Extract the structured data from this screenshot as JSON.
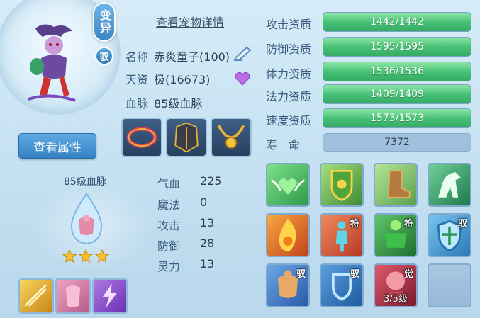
{
  "pet": {
    "mutation_badge": "变异",
    "bind_badge": "驭",
    "detail_link": "查看宠物详情",
    "name_label": "名称",
    "name_value": "赤炎童子(100)",
    "talent_label": "天资",
    "talent_value": "极(16673)",
    "bloodline_label": "血脉",
    "bloodline_value": "85级血脉",
    "view_attr_button": "查看属性"
  },
  "bloodline": {
    "label": "85级血脉",
    "stars": 3
  },
  "base_stats": [
    {
      "label": "气血",
      "value": "225"
    },
    {
      "label": "魔法",
      "value": "0"
    },
    {
      "label": "攻击",
      "value": "13"
    },
    {
      "label": "防御",
      "value": "28"
    },
    {
      "label": "灵力",
      "value": "13"
    }
  ],
  "aptitudes": [
    {
      "label": "攻击资质",
      "value": "1442/1442",
      "fill": 1.0
    },
    {
      "label": "防御资质",
      "value": "1595/1595",
      "fill": 1.0
    },
    {
      "label": "体力资质",
      "value": "1536/1536",
      "fill": 1.0
    },
    {
      "label": "法力资质",
      "value": "1409/1409",
      "fill": 1.0
    },
    {
      "label": "速度资质",
      "value": "1573/1573",
      "fill": 1.0
    }
  ],
  "lifespan": {
    "label": "寿　命",
    "value": "7372"
  },
  "skills": [
    {
      "icon": "heart-wings-icon"
    },
    {
      "icon": "shield-crest-icon"
    },
    {
      "icon": "boot-icon"
    },
    {
      "icon": "horse-icon"
    },
    {
      "icon": "fire-swirl-icon"
    },
    {
      "icon": "rune-figure-icon",
      "mark": "符"
    },
    {
      "icon": "green-giant-icon",
      "mark": "符"
    },
    {
      "icon": "blue-shield-icon",
      "mark": "驭"
    },
    {
      "icon": "muscle-icon",
      "mark": "驭"
    },
    {
      "icon": "guard-icon",
      "mark": "驭"
    },
    {
      "icon": "awaken-icon",
      "mark": "觉",
      "level": "3/5级"
    },
    {
      "icon": "empty-slot-icon"
    }
  ],
  "small_skills": [
    {
      "icon": "golden-strike-icon"
    },
    {
      "icon": "pink-body-icon"
    },
    {
      "icon": "purple-lightning-icon"
    }
  ],
  "equipment": [
    {
      "icon": "ring-collar-icon"
    },
    {
      "icon": "armor-icon"
    },
    {
      "icon": "amulet-necklace-icon"
    }
  ],
  "colors": {
    "bar_green": "#48c276",
    "bar_bg": "#5e88b3",
    "button_blue": "#3581c4"
  }
}
